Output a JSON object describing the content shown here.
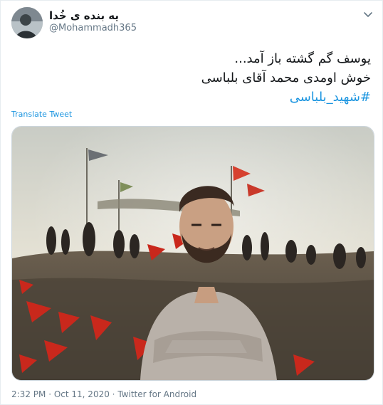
{
  "user": {
    "display_name": "یه بنده ی خُدا",
    "handle": "@Mohammadh365"
  },
  "tweet": {
    "line1": "یوسف گم گشته باز آمد...",
    "line2": "خوش اومدی محمد آقای بلباسی",
    "hashtag": "#شهید_بلباسی",
    "translate_label": "Translate Tweet",
    "time": "2:32 PM",
    "sep1": "·",
    "date": "Oct 11, 2020",
    "sep2": "·",
    "source": "Twitter for Android"
  },
  "icons": {
    "more": "chevron-down-icon"
  },
  "colors": {
    "link": "#1b95e0",
    "secondary_text": "#657786",
    "border": "#e6ecf0"
  }
}
